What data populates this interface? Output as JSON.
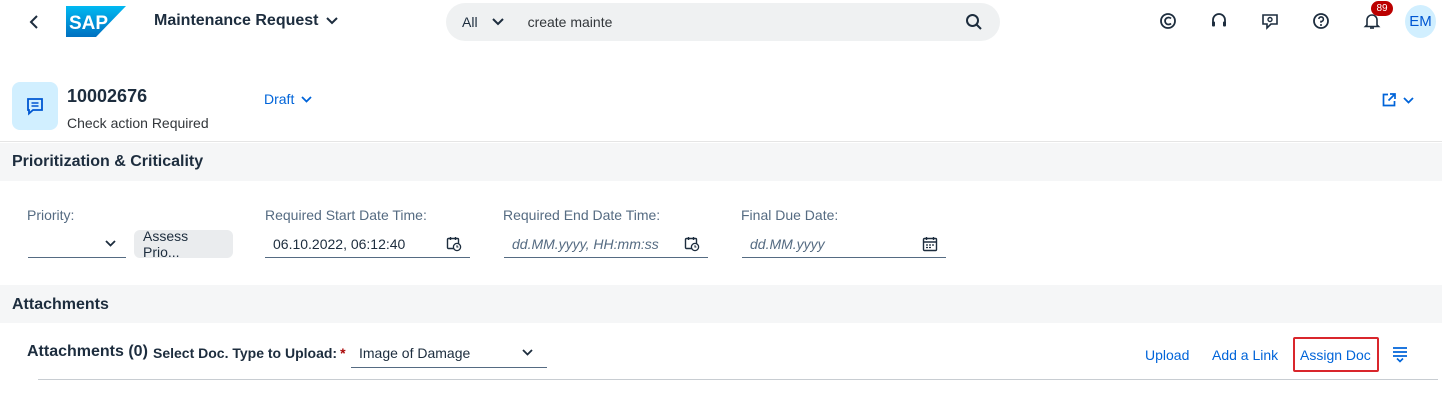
{
  "shell": {
    "app_title": "Maintenance Request",
    "logo_text": "SAP",
    "search_scope": "All",
    "search_value": "create mainte",
    "notification_count": "89",
    "avatar_initials": "EM"
  },
  "header": {
    "object_id": "10002676",
    "subtitle": "Check action Required",
    "status": "Draft"
  },
  "prioritization": {
    "title": "Prioritization & Criticality",
    "priority_label": "Priority:",
    "priority_value": "",
    "assess_button": "Assess Prio...",
    "start_label": "Required Start Date Time:",
    "start_value": "06.10.2022, 06:12:40",
    "end_label": "Required End Date Time:",
    "end_placeholder": "dd.MM.yyyy, HH:mm:ss",
    "due_label": "Final Due Date:",
    "due_placeholder": "dd.MM.yyyy"
  },
  "attachments": {
    "section_title": "Attachments",
    "table_title": "Attachments (0)",
    "doc_type_label": "Select Doc. Type to Upload:",
    "doc_type_value": "Image of Damage",
    "upload_link": "Upload",
    "add_link": "Add a Link",
    "assign_doc": "Assign Doc"
  },
  "colors": {
    "accent": "#0064d9",
    "highlight": "#d9262c",
    "badge": "#bb0000"
  }
}
